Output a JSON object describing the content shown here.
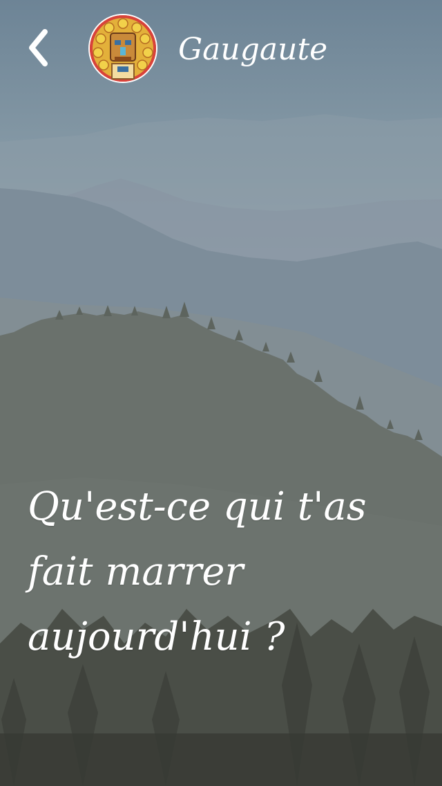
{
  "header": {
    "back_icon": "chevron-left-icon",
    "avatar_icon": "tiki-mask-avatar",
    "username": "Gaugaute"
  },
  "main": {
    "question": "Qu'est-ce qui t'as\nfait marrer\naujourd'hui ?"
  },
  "colors": {
    "text": "#ffffff",
    "sky_top": "#6d8496",
    "forest_bottom": "#3c3f38"
  }
}
